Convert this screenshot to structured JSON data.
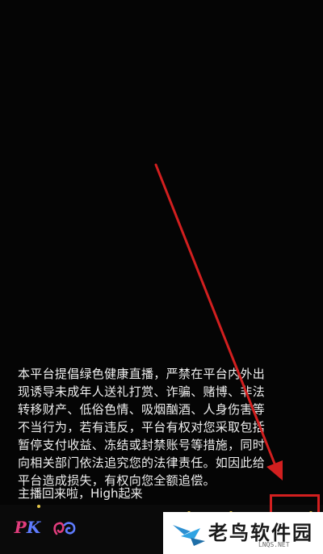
{
  "stream": {
    "notice_text": "本平台提倡绿色健康直播，严禁在平台内外出\n现诱导未成年人送礼打赏、诈骗、赌博、非法\n转移财产、低俗色情、吸烟酗酒、人身伤害等\n不当行为，若有违反，平台有权对您采取包括\n暂停支付收益、冻结或封禁账号等措施，同时\n向相关部门依法追究您的法律责任。如因此给\n平台造成损失，有权向您全额追偿。",
    "host_message": "主播回来啦，High起来"
  },
  "toolbar": {
    "pk_label_p": "P",
    "pk_label_k": "K"
  },
  "watermark": {
    "name": "老鸟软件园",
    "domain": "LNQS.NET"
  },
  "colors": {
    "annotation_red": "#d21f1f",
    "pk_pink": "#e23d7d",
    "pk_blue": "#5f7cff",
    "dot_yellow": "#e4c64a"
  }
}
